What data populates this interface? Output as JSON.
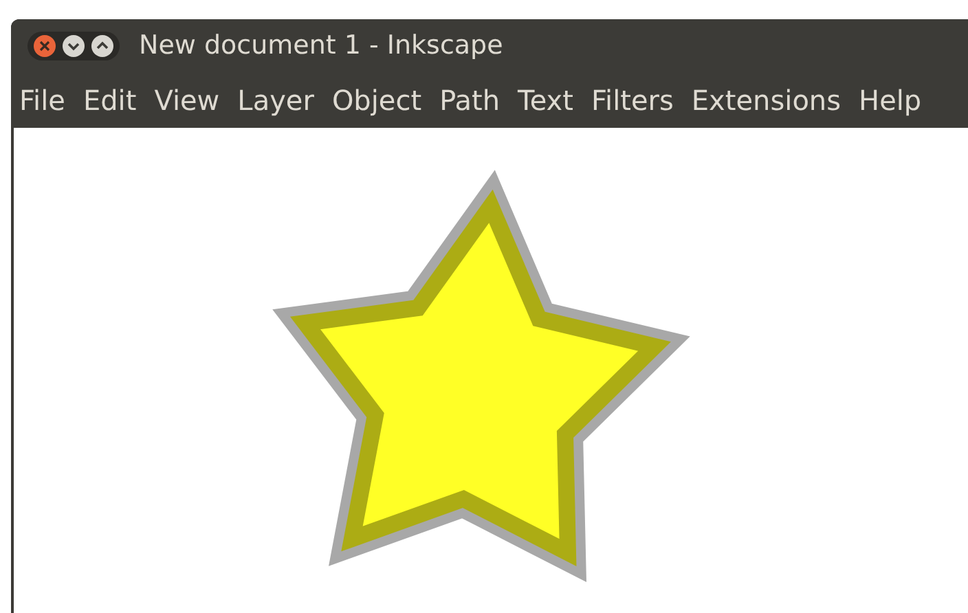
{
  "window": {
    "title": "New document 1 - Inkscape"
  },
  "menu": [
    {
      "label": "File"
    },
    {
      "label": "Edit"
    },
    {
      "label": "View"
    },
    {
      "label": "Layer"
    },
    {
      "label": "Object"
    },
    {
      "label": "Path"
    },
    {
      "label": "Text"
    },
    {
      "label": "Filters"
    },
    {
      "label": "Extensions"
    },
    {
      "label": "Help"
    }
  ]
}
